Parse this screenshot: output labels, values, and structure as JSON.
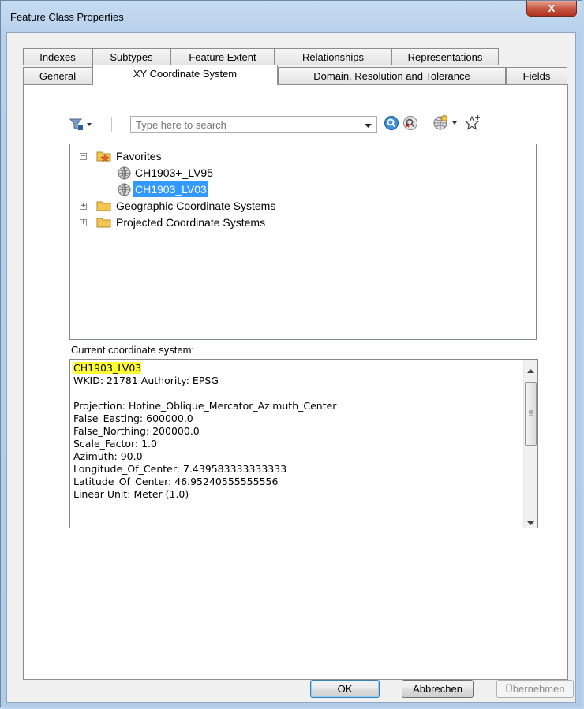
{
  "window": {
    "title": "Feature Class Properties",
    "close_label": "X"
  },
  "tabs_back": [
    "Indexes",
    "Subtypes",
    "Feature Extent",
    "Relationships",
    "Representations"
  ],
  "tabs_front": [
    "General",
    "XY Coordinate System",
    "Domain, Resolution and Tolerance",
    "Fields"
  ],
  "search": {
    "placeholder": "Type here to search"
  },
  "tree": {
    "favorites": "Favorites",
    "favorite_items": [
      "CH1903+_LV95",
      "CH1903_LV03"
    ],
    "geographic": "Geographic Coordinate Systems",
    "projected": "Projected Coordinate Systems"
  },
  "current_label": "Current coordinate system:",
  "details": [
    "CH1903_LV03",
    "WKID: 21781 Authority: EPSG",
    "",
    "Projection: Hotine_Oblique_Mercator_Azimuth_Center",
    "False_Easting: 600000.0",
    "False_Northing: 200000.0",
    "Scale_Factor: 1.0",
    "Azimuth: 90.0",
    "Longitude_Of_Center: 7.439583333333333",
    "Latitude_Of_Center: 46.95240555555556",
    "Linear Unit: Meter (1.0)"
  ],
  "buttons": {
    "ok": "OK",
    "cancel": "Abbrechen",
    "apply": "Übernehmen"
  }
}
